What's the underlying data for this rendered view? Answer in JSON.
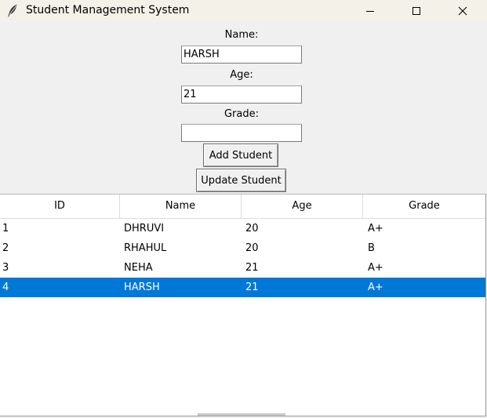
{
  "window": {
    "title": "Student Management System"
  },
  "form": {
    "name_label": "Name:",
    "name_value": "HARSH",
    "age_label": "Age:",
    "age_value": "21",
    "grade_label": "Grade:",
    "grade_value": "",
    "add_button": "Add Student",
    "update_button": "Update Student"
  },
  "table": {
    "columns": [
      "ID",
      "Name",
      "Age",
      "Grade"
    ],
    "rows": [
      {
        "id": "1",
        "name": "DHRUVI",
        "age": "20",
        "grade": "A+"
      },
      {
        "id": "2",
        "name": "RHAHUL",
        "age": "20",
        "grade": "B"
      },
      {
        "id": "3",
        "name": "NEHA",
        "age": "21",
        "grade": "A+"
      },
      {
        "id": "4",
        "name": "HARSH",
        "age": "21",
        "grade": "A+"
      }
    ],
    "selected_row": 3,
    "selection_color": "#0078d7"
  },
  "icons": {
    "app": "feather-icon",
    "minimize": "minimize-icon",
    "maximize": "maximize-icon",
    "close": "close-icon"
  }
}
